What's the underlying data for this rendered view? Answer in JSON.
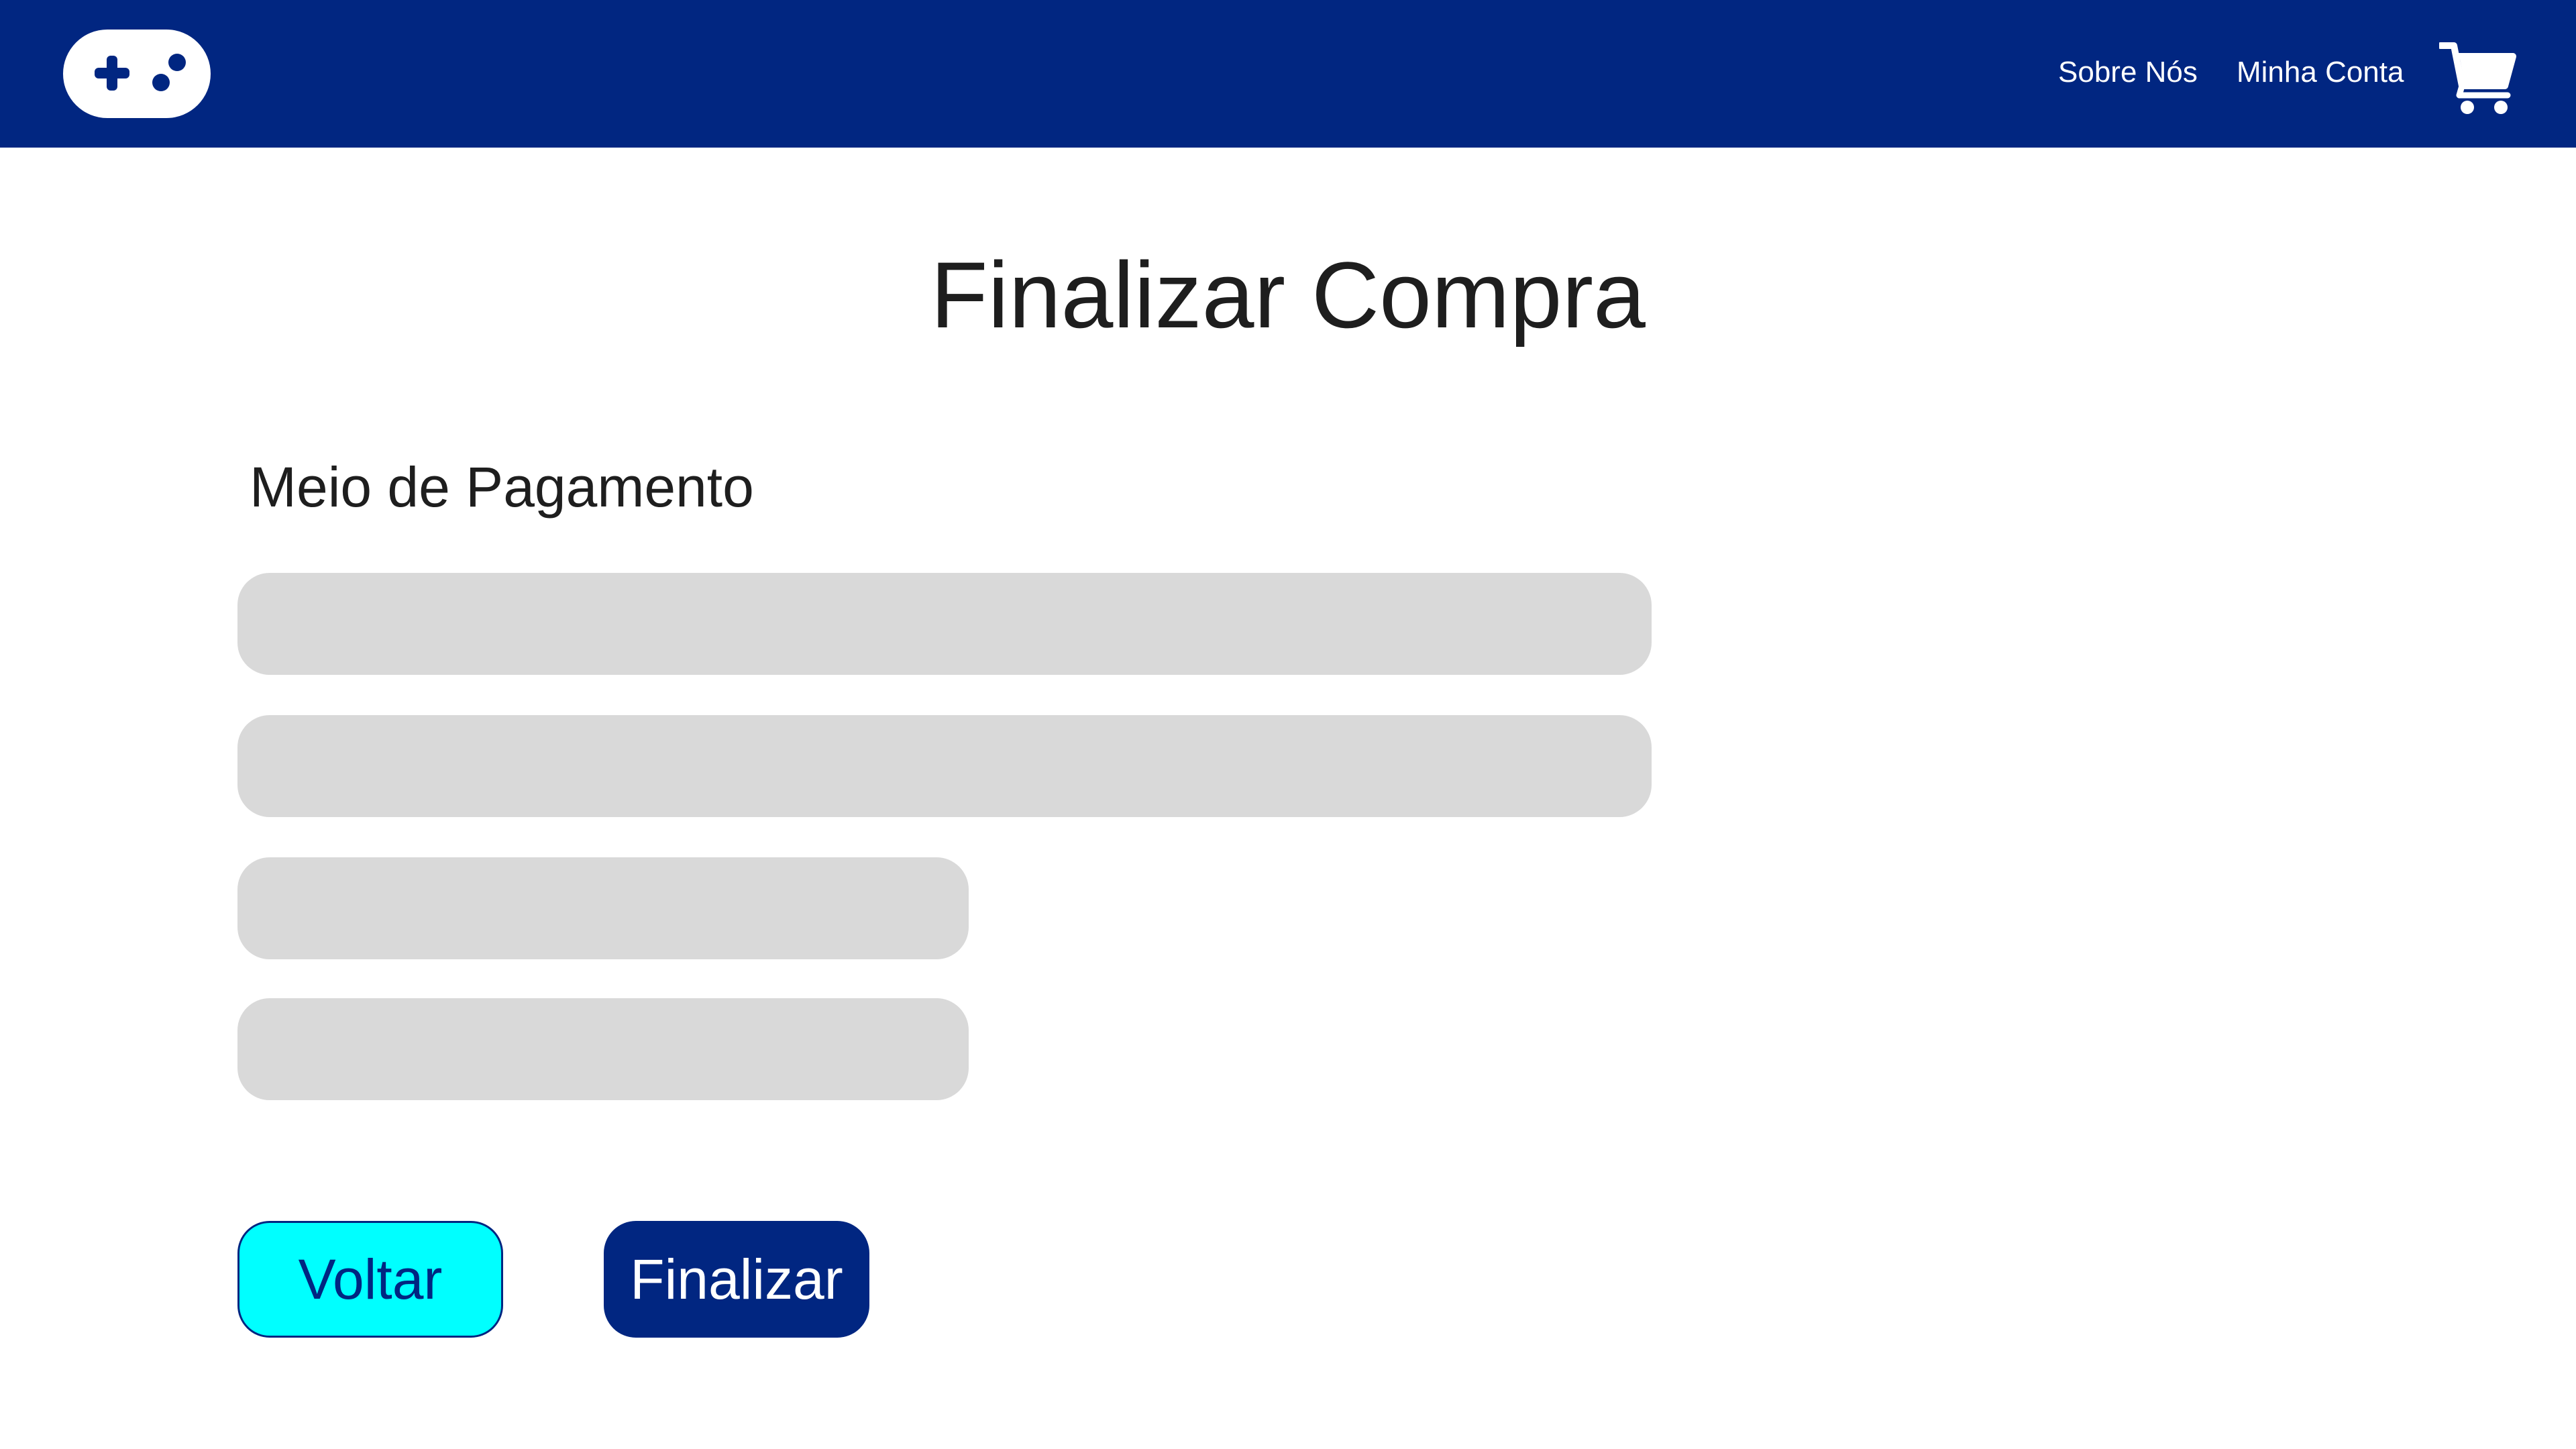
{
  "header": {
    "logo_icon": "gamepad-icon",
    "nav": {
      "about": "Sobre Nós",
      "account": "Minha Conta"
    },
    "cart_icon": "shopping-cart-icon",
    "background_color": "#012681"
  },
  "page": {
    "title": "Finalizar Compra",
    "payment_label": "Meio de Pagamento"
  },
  "form": {
    "fields": [
      {
        "value": "",
        "placeholder": ""
      },
      {
        "value": "",
        "placeholder": ""
      },
      {
        "value": "",
        "placeholder": ""
      },
      {
        "value": "",
        "placeholder": ""
      }
    ],
    "field_color": "#d9d9d9"
  },
  "buttons": {
    "back": "Voltar",
    "finish": "Finalizar",
    "back_color": "#00ffff",
    "finish_color": "#012681"
  }
}
